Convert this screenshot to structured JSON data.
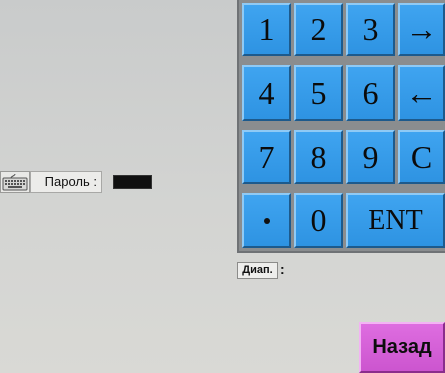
{
  "password": {
    "icon": "keyboard-icon",
    "label": "Пароль :",
    "value": ""
  },
  "keypad": {
    "keys": [
      {
        "id": "1",
        "label": "1"
      },
      {
        "id": "2",
        "label": "2"
      },
      {
        "id": "3",
        "label": "3"
      },
      {
        "id": "right",
        "label": "→"
      },
      {
        "id": "4",
        "label": "4"
      },
      {
        "id": "5",
        "label": "5"
      },
      {
        "id": "6",
        "label": "6"
      },
      {
        "id": "left",
        "label": "←"
      },
      {
        "id": "7",
        "label": "7"
      },
      {
        "id": "8",
        "label": "8"
      },
      {
        "id": "9",
        "label": "9"
      },
      {
        "id": "clear",
        "label": "C"
      },
      {
        "id": "dot",
        "label": "·"
      },
      {
        "id": "0",
        "label": "0"
      },
      {
        "id": "enter",
        "label": "ENT"
      }
    ]
  },
  "range": {
    "label": "Диап.",
    "separator": ":"
  },
  "back_button": {
    "label": "Назад"
  },
  "colors": {
    "key_blue": "#3a9fee",
    "back_purple": "#d863da",
    "background": "#cfd0ce"
  }
}
